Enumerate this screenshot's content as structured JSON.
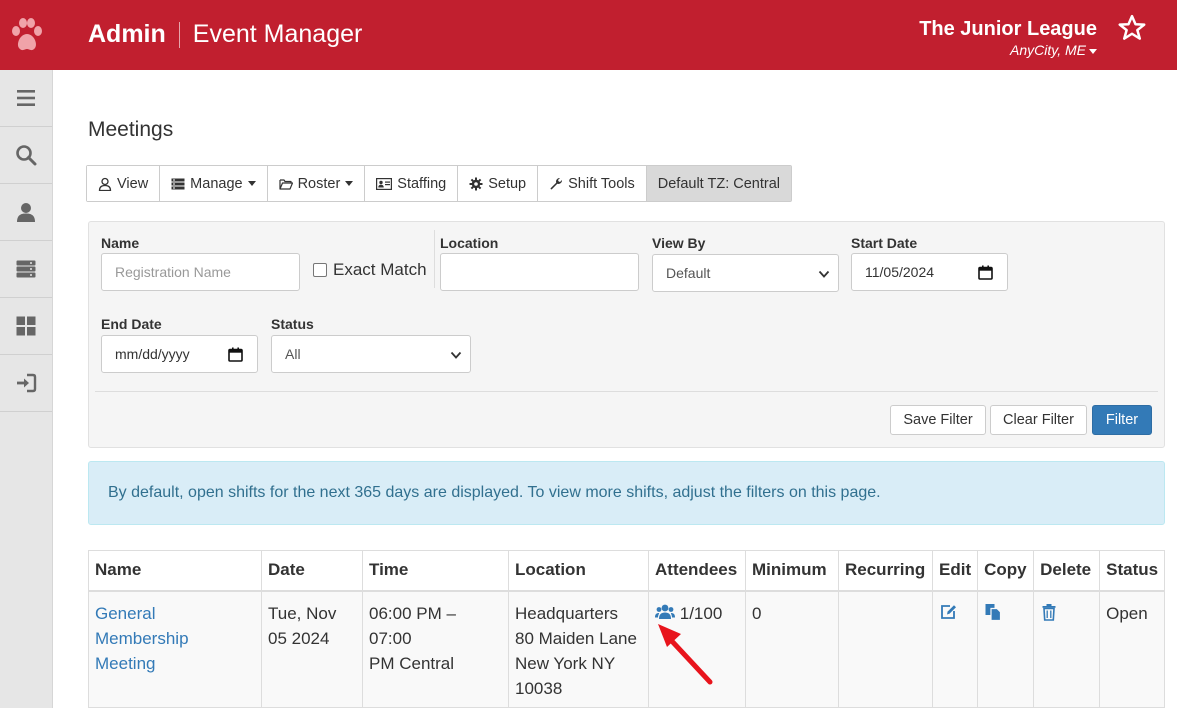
{
  "header": {
    "brand": "Admin",
    "app_name": "Event Manager",
    "org_name": "The Junior League",
    "org_city": "AnyCity, ME",
    "colors": {
      "brand": "#c11f2f",
      "accent": "#337ab7"
    }
  },
  "sidebar": {
    "items": [
      {
        "icon": "menu-icon"
      },
      {
        "icon": "search-icon"
      },
      {
        "icon": "user-icon"
      },
      {
        "icon": "server-icon"
      },
      {
        "icon": "dashboard-icon"
      },
      {
        "icon": "sign-in-icon"
      }
    ]
  },
  "page": {
    "title": "Meetings"
  },
  "toolbar": {
    "view": "View",
    "manage": "Manage",
    "roster": "Roster",
    "staffing": "Staffing",
    "setup": "Setup",
    "shift_tools": "Shift Tools",
    "default_tz": "Default TZ: Central"
  },
  "filters": {
    "name_label": "Name",
    "name_placeholder": "Registration Name",
    "exact_match": "Exact Match",
    "location_label": "Location",
    "location_value": "",
    "view_by_label": "View By",
    "view_by_value": "Default",
    "start_date_label": "Start Date",
    "start_date_value": "11/05/2024",
    "end_date_label": "End Date",
    "end_date_value": "mm/dd/yyyy",
    "status_label": "Status",
    "status_value": "All",
    "save_filter": "Save Filter",
    "clear_filter": "Clear Filter",
    "filter": "Filter"
  },
  "info_message": "By default, open shifts for the next 365 days are displayed. To view more shifts, adjust the filters on this page.",
  "table": {
    "headers": [
      "Name",
      "Date",
      "Time",
      "Location",
      "Attendees",
      "Minimum",
      "Recurring",
      "Edit",
      "Copy",
      "Delete",
      "Status"
    ],
    "rows": [
      {
        "name_line1": "General",
        "name_line2": "Membership",
        "name_line3": "Meeting",
        "date_line1": "Tue, Nov",
        "date_line2": "05 2024",
        "time_line1": "06:00 PM – 07:00",
        "time_line2": "PM Central",
        "location_line1": "Headquarters",
        "location_line2": "80 Maiden Lane",
        "location_line3": "New York NY",
        "location_line4": "10038",
        "attendees": "1/100",
        "minimum": "0",
        "recurring": "",
        "status": "Open"
      }
    ]
  }
}
